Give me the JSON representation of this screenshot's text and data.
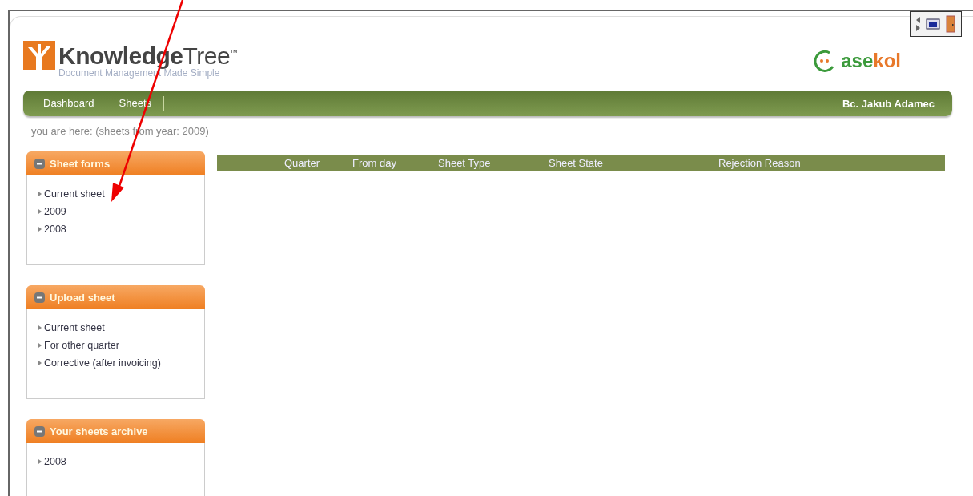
{
  "logo": {
    "title": "**Knowledge**Tree$^{™}$",
    "tagline": "Document Management Made Simple"
  },
  "partner_logo": {
    "part_1": "ase",
    "part_2": "kol"
  },
  "nav": {
    "items": [
      {
        "label": "Dashboard"
      },
      {
        "label": "Sheets"
      }
    ],
    "user": "Bc. Jakub Adamec"
  },
  "breadcrumb": "you are here: (sheets from year: 2009)",
  "sidebar": [
    {
      "title": "Sheet forms",
      "expanded": true,
      "items": [
        "Current sheet",
        "2009",
        "2008"
      ]
    },
    {
      "title": "Upload sheet",
      "expanded": true,
      "items": [
        "Current sheet",
        "For other quarter",
        "Corrective (after invoicing)"
      ]
    },
    {
      "title": "Your sheets archive",
      "expanded": true,
      "items": [
        "2008"
      ]
    }
  ],
  "table": {
    "columns": [
      "Quarter",
      "From day",
      "Sheet Type",
      "Sheet State",
      "Rejection Reason"
    ]
  }
}
